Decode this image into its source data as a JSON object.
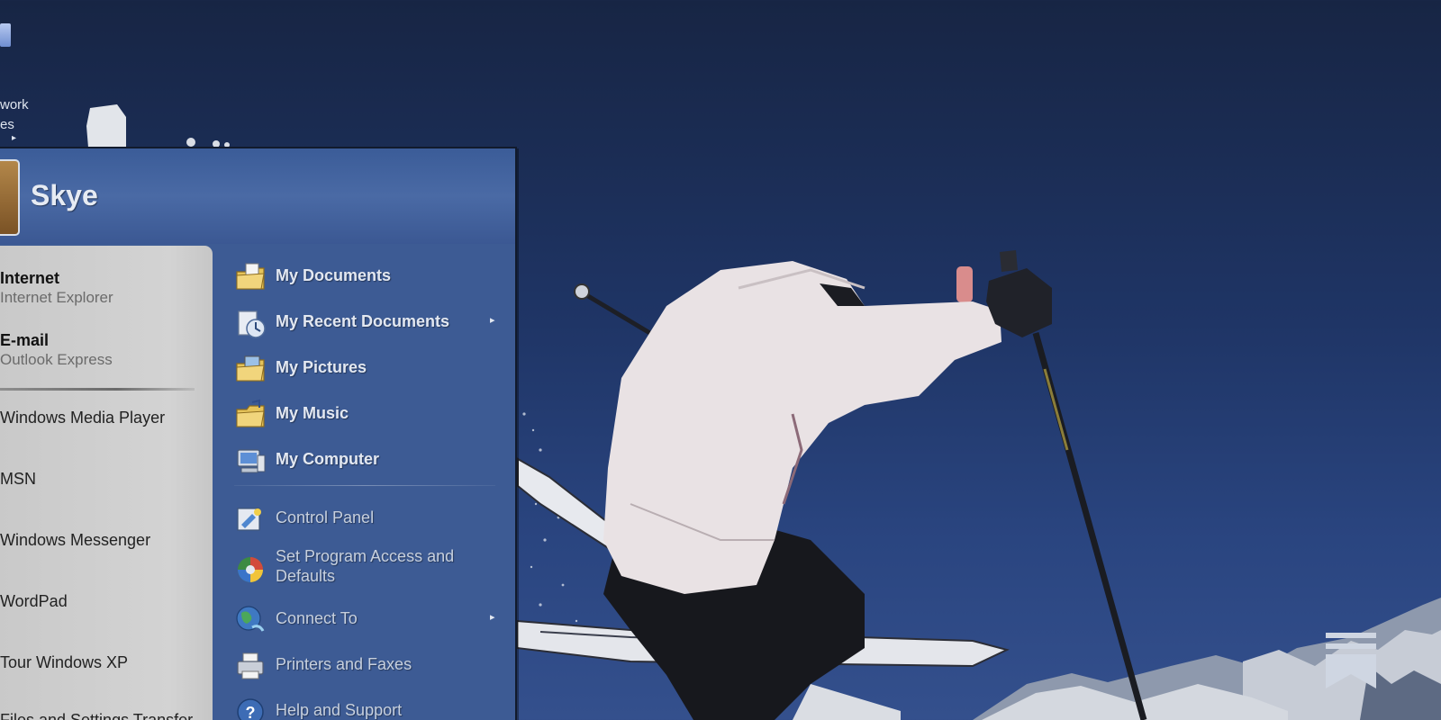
{
  "desktop": {
    "icon_label_line1": "work",
    "icon_label_line2": "es",
    "icon_arrow": "▸",
    "icon": "network-places-icon"
  },
  "start_menu": {
    "user_name": "Skye",
    "avatar": "chess-piece-avatar",
    "pinned": [
      {
        "title": "Internet",
        "subtitle": "Internet Explorer",
        "icon": "internet-explorer-icon"
      },
      {
        "title": "E-mail",
        "subtitle": "Outlook Express",
        "icon": "outlook-express-icon"
      }
    ],
    "programs": [
      {
        "label": "Windows Media Player"
      },
      {
        "label": "MSN"
      },
      {
        "label": "Windows Messenger"
      },
      {
        "label": "WordPad"
      },
      {
        "label": "Tour Windows XP"
      },
      {
        "label": "Files and Settings Transfer..."
      }
    ],
    "places": [
      {
        "label": "My Documents",
        "icon": "my-documents-icon"
      },
      {
        "label": "My Recent Documents",
        "icon": "recent-documents-icon",
        "submenu_arrow": "▸"
      },
      {
        "label": "My Pictures",
        "icon": "my-pictures-icon"
      },
      {
        "label": "My Music",
        "icon": "my-music-icon"
      },
      {
        "label": "My Computer",
        "icon": "my-computer-icon"
      }
    ],
    "system": [
      {
        "label": "Control Panel",
        "icon": "control-panel-icon"
      },
      {
        "label": "Set Program Access and Defaults",
        "icon": "program-access-icon"
      },
      {
        "label": "Connect To",
        "icon": "connect-to-icon",
        "submenu_arrow": "▸"
      },
      {
        "label": "Printers and Faxes",
        "icon": "printers-faxes-icon"
      },
      {
        "label": "Help and Support",
        "icon": "help-support-icon"
      }
    ]
  },
  "logo": {
    "icon": "bookmark-logo-icon"
  },
  "colors": {
    "sky_top": "#172544",
    "sky_bottom": "#34508d",
    "menu_blue": "#3d5b94",
    "left_panel_gray": "#cfcfcf"
  }
}
